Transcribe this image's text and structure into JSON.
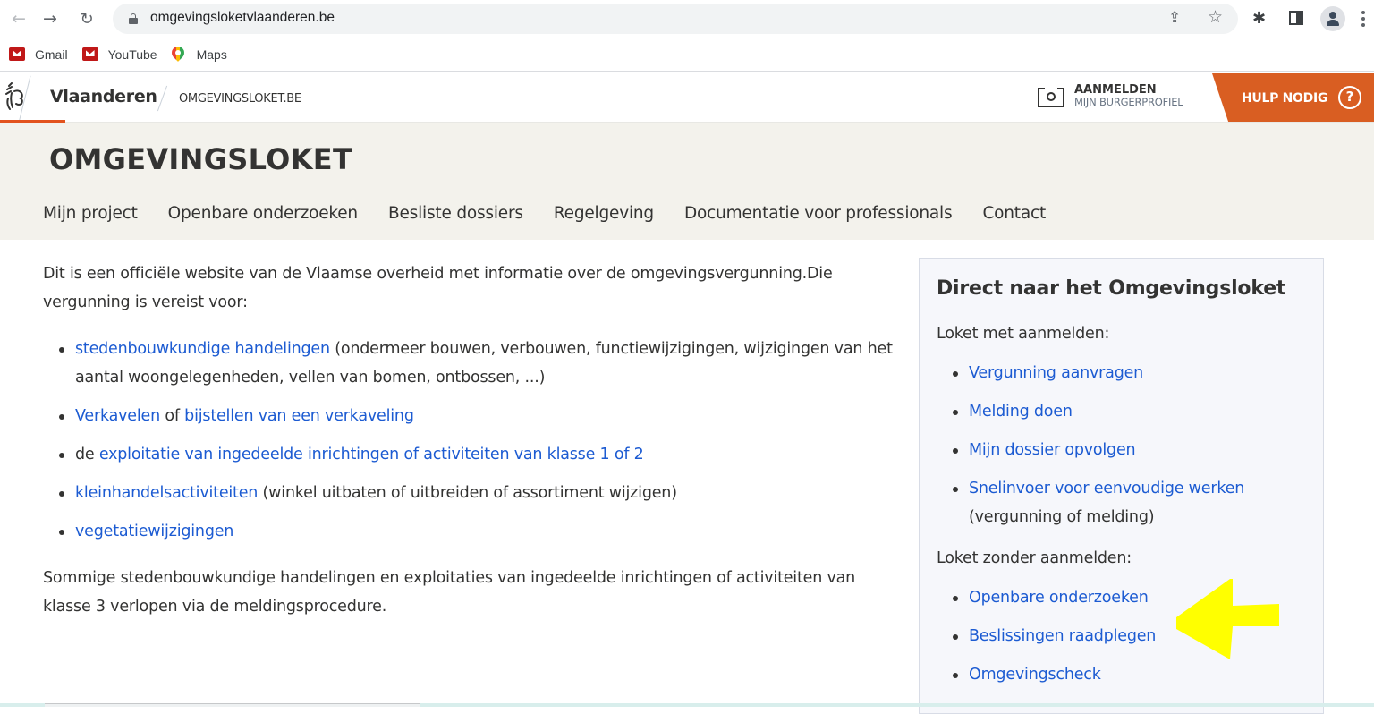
{
  "browser": {
    "url": "omgevingsloketvlaanderen.be",
    "icons": {
      "back": "arrow-left-icon",
      "forward": "arrow-right-icon",
      "reload": "reload-icon",
      "lock": "lock-icon",
      "share": "share-icon",
      "bookmark": "star-icon",
      "extensions": "puzzle-icon",
      "side_panel": "side-panel-icon",
      "profile": "profile-icon",
      "menu": "kebab-menu-icon"
    },
    "glyphs": {
      "back": "←",
      "forward": "→",
      "reload": "↻",
      "share": "⇪",
      "star": "☆",
      "puzzle": "✱"
    },
    "bookmarks": [
      {
        "label": "Gmail",
        "icon": "mcafee-icon"
      },
      {
        "label": "YouTube",
        "icon": "mcafee-icon"
      },
      {
        "label": "Maps",
        "icon": "maps-pin-icon"
      }
    ]
  },
  "header": {
    "brand": "Vlaanderen",
    "site": "OMGEVINGSLOKET.BE",
    "login_title": "AANMELDEN",
    "login_sub": "MIJN BURGERPROFIEL",
    "help_label": "HULP NODIG",
    "help_glyph": "?",
    "accent_color": "#d95e22"
  },
  "title_band": {
    "title": "OMGEVINGSLOKET",
    "nav": [
      "Mijn project",
      "Openbare onderzoeken",
      "Besliste dossiers",
      "Regelgeving",
      "Documentatie voor professionals",
      "Contact"
    ]
  },
  "content": {
    "intro": "Dit is een officiële website van de Vlaamse overheid met informatie over de omgevingsvergunning.Die vergunning is vereist voor:",
    "items": [
      {
        "link": "stedenbouwkundige handelingen",
        "after": " (ondermeer bouwen, verbouwen, functiewijzigingen, wijzigingen van het aantal woongelegenheden, vellen van bomen, ontbossen, ...)"
      },
      {
        "link": "Verkavelen",
        "middle": " of ",
        "link2": "bijstellen van een verkaveling"
      },
      {
        "before": "de ",
        "link": "exploitatie van ingedeelde inrichtingen of activiteiten van klasse 1 of 2"
      },
      {
        "link": "kleinhandelsactiviteiten",
        "after": " (winkel uitbaten of uitbreiden of assortiment wijzigen)"
      },
      {
        "link": "vegetatiewijzigingen"
      }
    ],
    "outro": "Sommige stedenbouwkundige handelingen en exploitaties van ingedeelde inrichtingen of activiteiten van klasse 3 verlopen via de meldingsprocedure."
  },
  "sidebar": {
    "title": "Direct naar het Omgevingsloket",
    "with_login_label": "Loket met aanmelden:",
    "with_login": [
      {
        "link": "Vergunning aanvragen"
      },
      {
        "link": "Melding doen"
      },
      {
        "link": "Mijn dossier opvolgen"
      },
      {
        "link": "Snelinvoer voor eenvoudige werken",
        "after": " (vergunning of melding)"
      }
    ],
    "without_login_label": "Loket zonder aanmelden:",
    "without_login": [
      {
        "link": "Openbare onderzoeken"
      },
      {
        "link": "Beslissingen raadplegen"
      },
      {
        "link": "Omgevingscheck"
      }
    ]
  },
  "annotation": {
    "type": "arrow",
    "direction": "left",
    "color": "#ffff00",
    "points_to": "Openbare onderzoeken"
  },
  "colors": {
    "link": "#1c5bd2",
    "text": "#333332",
    "band_bg": "#f3f2ec",
    "sidebar_bg": "#f6f7fb"
  }
}
